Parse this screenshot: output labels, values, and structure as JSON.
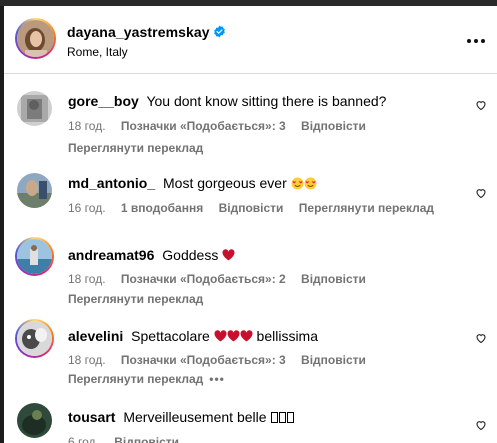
{
  "post": {
    "username": "dayana_yastremskay",
    "location": "Rome, Italy",
    "more_icon": "more-horizontal-icon",
    "verified_icon": "verified-badge-icon"
  },
  "comments": [
    {
      "username": "gore__boy",
      "text": "You dont know sitting there is banned?",
      "time": "18 год.",
      "likes": "Позначки «Подобається»: 3",
      "reply": "Відповісти",
      "translate": "Переглянути переклад"
    },
    {
      "username": "md_antonio_",
      "text": "Most gorgeous ever",
      "emoji": "😍😍",
      "time": "16 год.",
      "likes": "1 вподобання",
      "reply": "Відповісти",
      "translate": "Переглянути переклад"
    },
    {
      "username": "andreamat96",
      "text": "Goddess",
      "emoji": "❤",
      "time": "18 год.",
      "likes": "Позначки «Подобається»: 2",
      "reply": "Відповісти",
      "translate": "Переглянути переклад"
    },
    {
      "username": "alevelini",
      "text_before": "Spettacolare",
      "emoji": "❤❤❤",
      "text_after": "bellissima",
      "time": "18 год.",
      "likes": "Позначки «Подобається»: 3",
      "reply": "Відповісти",
      "translate": "Переглянути переклад",
      "more": "•••"
    },
    {
      "username": "tousart",
      "text": "Merveilleusement belle",
      "unrendered_glyphs": "���",
      "time": "6 год.",
      "reply": "Відповісти"
    }
  ],
  "colors": {
    "meta": "#737373",
    "heart": "#c8102e",
    "verified": "#0095f6",
    "divider": "#dbdbdb"
  }
}
